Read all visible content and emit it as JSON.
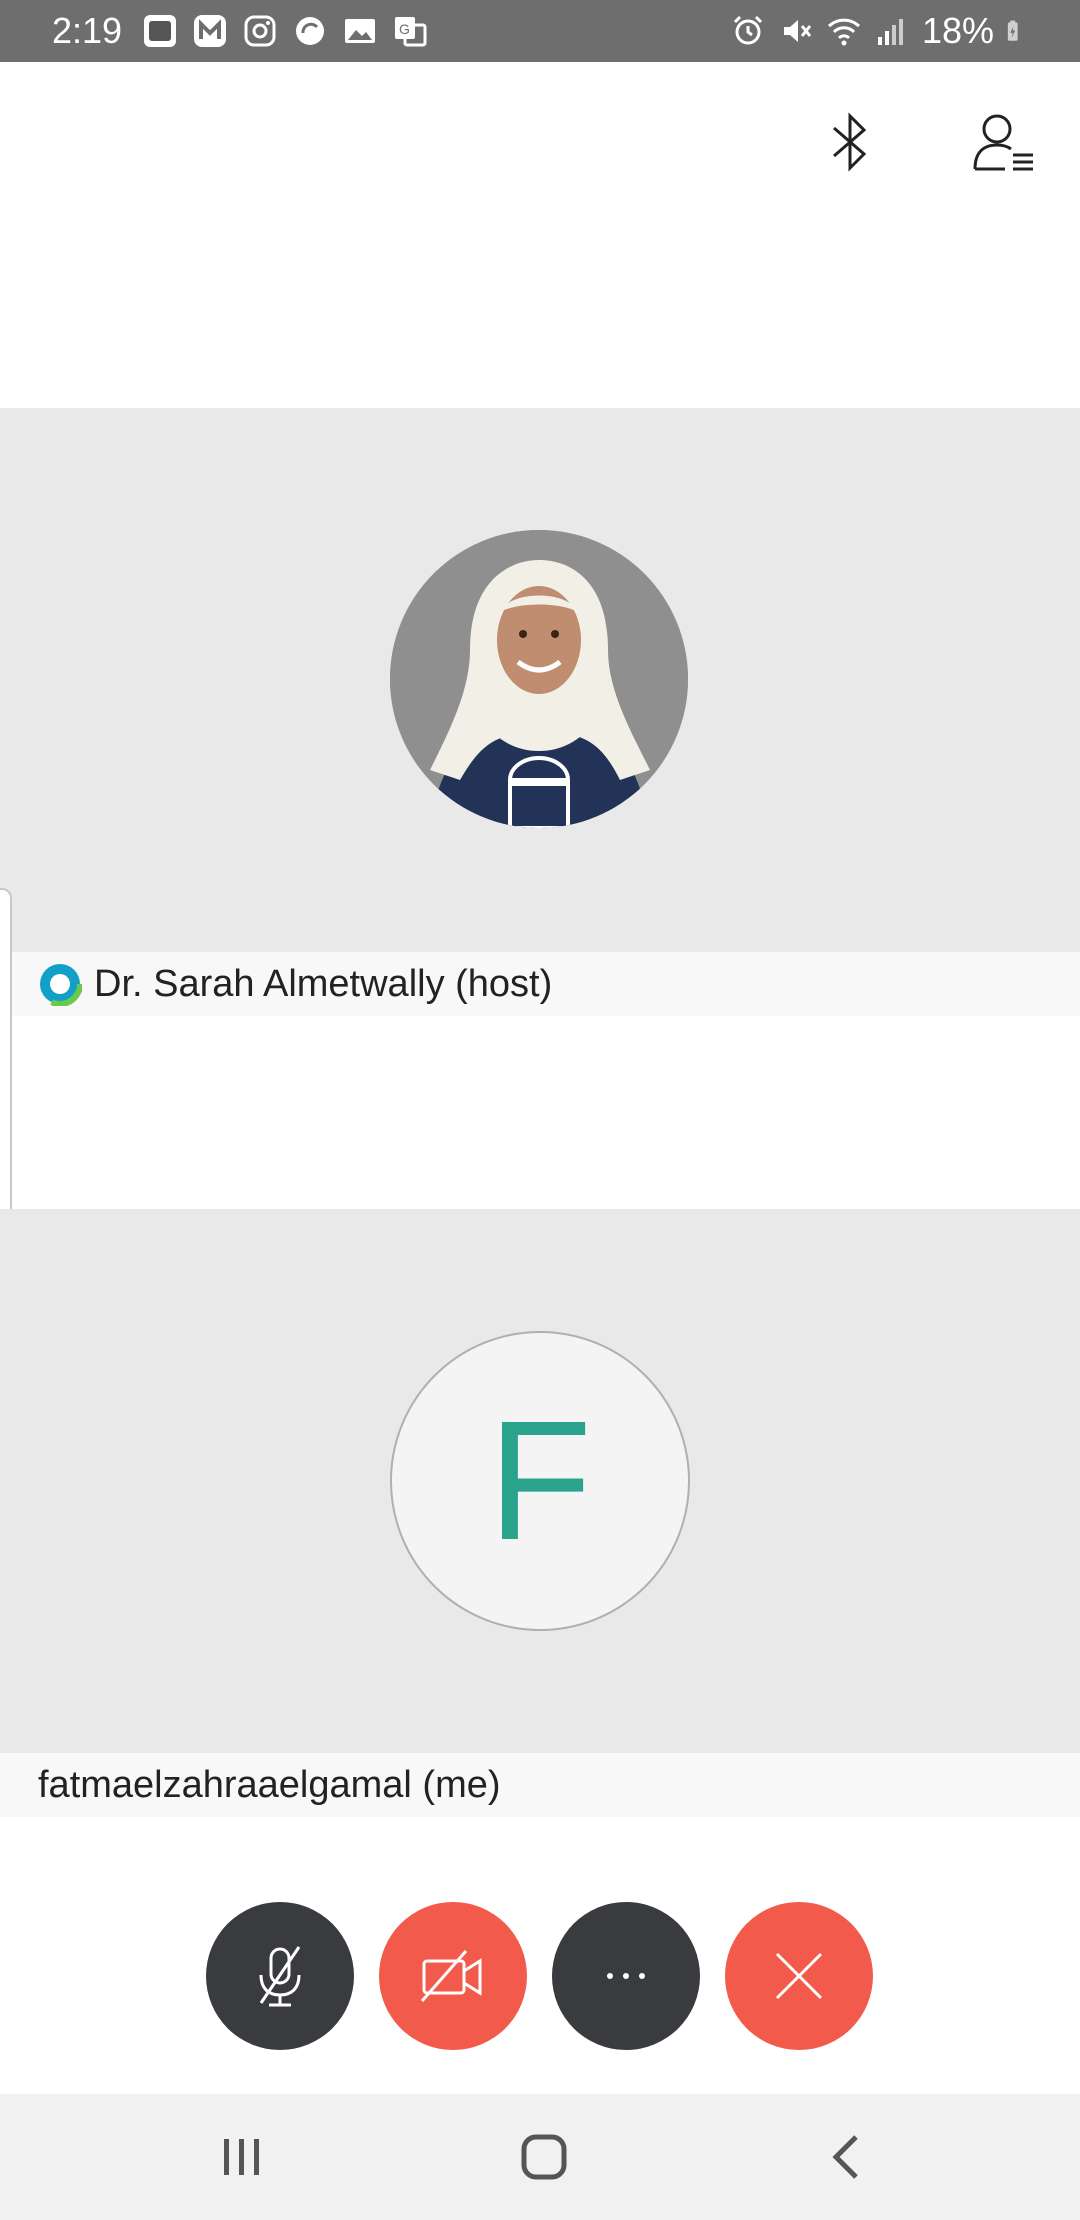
{
  "status_bar": {
    "time": "2:19",
    "battery": "18%",
    "left_icons": [
      "app-icon",
      "messenger-icon",
      "instagram-icon",
      "sync-icon",
      "gallery-icon",
      "translate-icon"
    ],
    "right_icons": [
      "alarm-icon",
      "mute-icon",
      "wifi-icon",
      "signal-icon",
      "battery-charging-icon"
    ],
    "background": "#6e6e6e"
  },
  "toolbar": {
    "icons": [
      "bluetooth-icon",
      "participants-icon"
    ]
  },
  "participants": [
    {
      "name": "Dr. Sarah Almetwally (host)",
      "avatar_type": "photo",
      "badge_icon": "webex-host-icon"
    },
    {
      "name": "fatmaelzahraaelgamal (me)",
      "avatar_type": "initial",
      "initial": "F",
      "initial_color": "#2aa38d"
    }
  ],
  "controls": {
    "mute": {
      "icon": "mic-off-icon",
      "color": "#393b3f"
    },
    "video": {
      "icon": "video-off-icon",
      "color": "#f25a4b"
    },
    "more": {
      "icon": "more-icon",
      "color": "#393b3f"
    },
    "end": {
      "icon": "close-icon",
      "color": "#f25a4b"
    }
  },
  "nav_bar": {
    "icons": [
      "recents-icon",
      "home-icon",
      "back-icon"
    ]
  }
}
